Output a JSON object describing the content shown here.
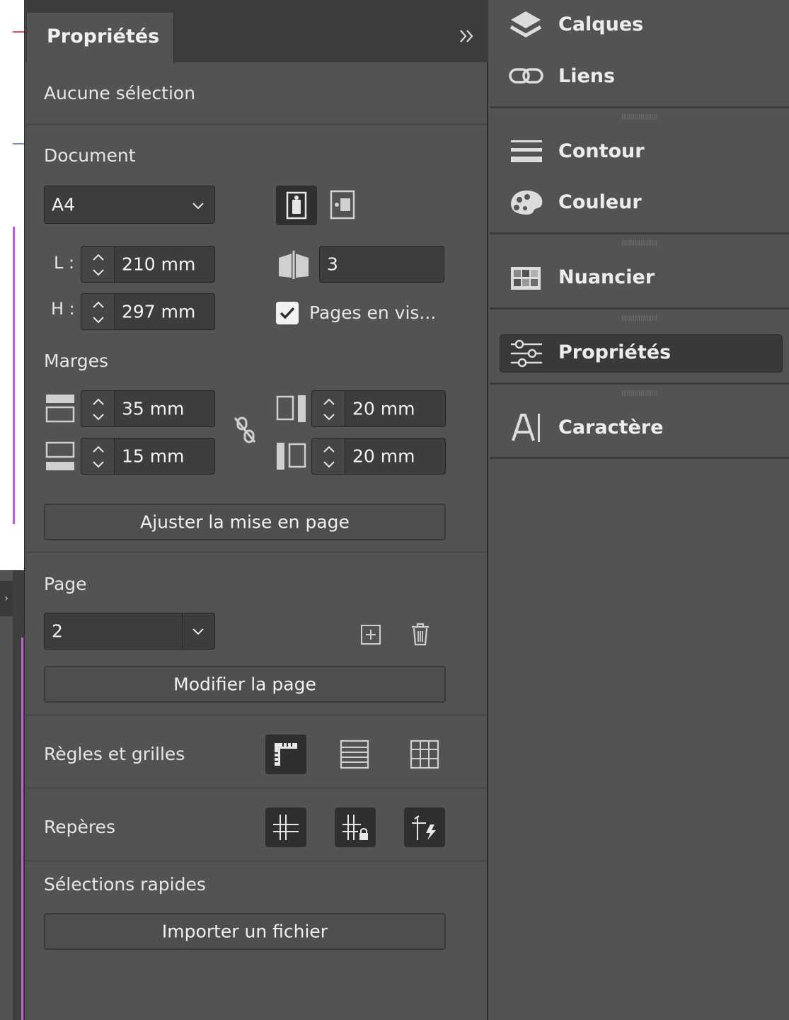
{
  "panel": {
    "tab_label": "Propriétés",
    "collapse_icon": "double-chevron-right-icon",
    "selection_status": "Aucune sélection"
  },
  "document": {
    "title": "Document",
    "preset": "A4",
    "width_label": "L :",
    "width_value": "210 mm",
    "height_label": "H :",
    "height_value": "297 mm",
    "pages_count": "3",
    "facing_pages_checked": true,
    "facing_pages_label": "Pages en vis..."
  },
  "margins": {
    "title": "Marges",
    "top": "35 mm",
    "bottom": "15 mm",
    "inside": "20 mm",
    "outside": "20 mm",
    "adjust_button": "Ajuster la mise en page"
  },
  "page": {
    "title": "Page",
    "current_page": "2",
    "edit_button": "Modifier la page"
  },
  "rulers": {
    "title": "Règles et grilles"
  },
  "guides": {
    "title": "Repères"
  },
  "quick_actions": {
    "title": "Sélections rapides",
    "import_button": "Importer un fichier"
  },
  "dock": {
    "items": [
      {
        "label": "Calques",
        "icon": "layers-icon"
      },
      {
        "label": "Liens",
        "icon": "links-icon"
      },
      {
        "label": "Contour",
        "icon": "stroke-icon"
      },
      {
        "label": "Couleur",
        "icon": "color-palette-icon"
      },
      {
        "label": "Nuancier",
        "icon": "swatches-icon"
      },
      {
        "label": "Propriétés",
        "icon": "properties-sliders-icon",
        "active": true
      },
      {
        "label": "Caractère",
        "icon": "character-icon"
      }
    ]
  },
  "colors": {
    "panel_bg": "#535353",
    "field_bg": "#3d3d3d",
    "header_bg": "#3c3c3c",
    "canvas_white": "#ffffff",
    "accent_magenta": "#c05cd6"
  }
}
